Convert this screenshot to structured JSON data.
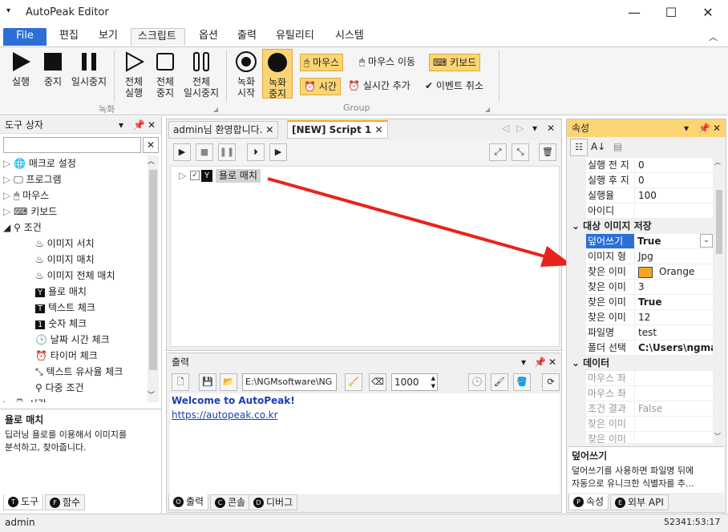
{
  "window": {
    "title": "AutoPeak Editor"
  },
  "menu": {
    "file": "File",
    "items": [
      "편집",
      "보기",
      "스크립트",
      "옵션",
      "출력",
      "유틸리티",
      "시스템"
    ]
  },
  "ribbon": {
    "run": "실행",
    "stop": "중지",
    "pause": "일시중지",
    "run_all_1": "전체",
    "run_all_2": "실행",
    "stop_all_1": "전체",
    "stop_all_2": "중지",
    "pause_all_1": "전체",
    "pause_all_2": "일시중지",
    "group_record": "녹화",
    "rec_start_1": "녹화",
    "rec_start_2": "시작",
    "rec_stop_1": "녹화",
    "rec_stop_2": "중지",
    "mouse": "마우스",
    "mouse_move": "마우스 이동",
    "keyboard": "키보드",
    "time": "시간",
    "realtime_add": "실시간 추가",
    "event_cancel": "이벤트 취소",
    "group_group": "Group"
  },
  "toolbox": {
    "title": "도구 상자",
    "items": [
      "매크로 설정",
      "프로그램",
      "마우스",
      "키보드",
      "조건"
    ],
    "children": [
      "이미지 서치",
      "이미지 매치",
      "이미지 전체 매치",
      "욜로 매치",
      "텍스트 체크",
      "숫자 체크",
      "날짜 시간 체크",
      "타이머 체크",
      "텍스트 유사율 체크",
      "다중 조건"
    ],
    "partial": "시간",
    "desc_title": "욜로 매치",
    "desc_1": "딥러닝 욜로를 이용해서 이미지를",
    "desc_2": "분석하고, 찾아줍니다.",
    "tab_tools": "도구",
    "tab_func": "함수"
  },
  "editor": {
    "tab_welcome": "admin님 환영합니다.",
    "tab_script": "[NEW] Script 1",
    "node_label": "욜로 매치"
  },
  "output": {
    "title": "출력",
    "path": "E:\\NGMsoftware\\NG",
    "count": "1000",
    "line1": "Welcome to AutoPeak!",
    "line2": "https://autopeak.co.kr",
    "tab_output": "출력",
    "tab_console": "콘솔",
    "tab_debug": "디버그"
  },
  "props": {
    "title": "속성",
    "rows1": [
      [
        "실행 전 지",
        "0"
      ],
      [
        "실행 후 지",
        "0"
      ],
      [
        "실행율",
        "100"
      ],
      [
        "아이디",
        ""
      ]
    ],
    "cat_image": "대상 이미지 저장",
    "overwrite_label": "덮어쓰기",
    "overwrite_value": "True",
    "rows2": [
      [
        "이미지 형",
        "Jpg"
      ],
      [
        "찾은 이미",
        "Orange"
      ],
      [
        "찾은 이미",
        "3"
      ],
      [
        "찾은 이미",
        "True"
      ],
      [
        "찾은 이미",
        "12"
      ],
      [
        "파일명",
        "test"
      ],
      [
        "폴더 선택",
        "C:\\Users\\ngma"
      ]
    ],
    "cat_data": "데이터",
    "rows3": [
      [
        "마우스 좌",
        ""
      ],
      [
        "마우스 좌",
        ""
      ],
      [
        "조건 결과",
        "False"
      ],
      [
        "찾은 이미",
        ""
      ],
      [
        "찾은 이미",
        ""
      ]
    ],
    "desc_title": "덮어쓰기",
    "desc_1": "덮어쓰기를 사용하면 파일명 뒤에",
    "desc_2": "자동으로 유니크한 식별자를 추...",
    "tab_props": "속성",
    "tab_api": "외부 API",
    "accent": "#f5a623"
  },
  "status": {
    "user": "admin",
    "coords": "52341:53:17"
  }
}
